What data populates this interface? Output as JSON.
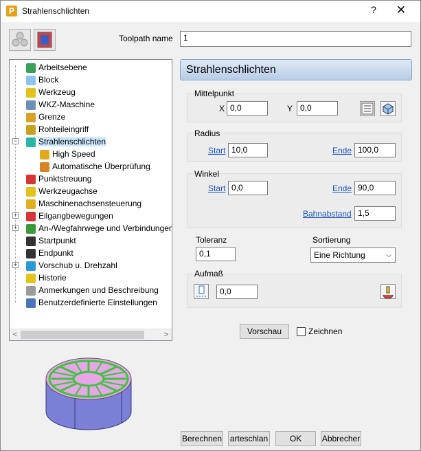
{
  "window": {
    "title": "Strahlenschlichten",
    "help": "?",
    "close": "✕",
    "app_icon_letter": "P"
  },
  "toolpath_name": {
    "label": "Toolpath name",
    "value": "1"
  },
  "tree": {
    "items": [
      {
        "label": "Arbeitsebene",
        "icon": "workplane-icon",
        "color": "#3aa05a"
      },
      {
        "label": "Block",
        "icon": "block-icon",
        "color": "#8fc3ec"
      },
      {
        "label": "Werkzeug",
        "icon": "tool-icon",
        "color": "#e3c21c"
      },
      {
        "label": "WKZ-Maschine",
        "icon": "machine-tool-icon",
        "color": "#6e8fb5"
      },
      {
        "label": "Grenze",
        "icon": "boundary-icon",
        "color": "#d9a02a"
      },
      {
        "label": "Rohteileingriff",
        "icon": "stock-engagement-icon",
        "color": "#c9a020"
      },
      {
        "label": "Strahlenschlichten",
        "icon": "radial-finishing-icon",
        "color": "#27b5a6"
      },
      {
        "label": "High Speed",
        "icon": "high-speed-icon",
        "color": "#e3a91c"
      },
      {
        "label": "Automatische Überprüfung",
        "icon": "auto-verify-icon",
        "color": "#d98424"
      },
      {
        "label": "Punktstreuung",
        "icon": "point-distribution-icon",
        "color": "#d73535"
      },
      {
        "label": "Werkzeugachse",
        "icon": "tool-axis-icon",
        "color": "#e3c21c"
      },
      {
        "label": "Maschinenachsensteuerung",
        "icon": "axis-control-icon",
        "color": "#e0b020"
      },
      {
        "label": "Eilgangbewegungen",
        "icon": "rapid-moves-icon",
        "color": "#d73535"
      },
      {
        "label": "An-/Wegfahrwege und Verbindungen",
        "icon": "leads-links-icon",
        "color": "#3a9a3a"
      },
      {
        "label": "Startpunkt",
        "icon": "start-point-icon",
        "color": "#333333"
      },
      {
        "label": "Endpunkt",
        "icon": "end-point-icon",
        "color": "#333333"
      },
      {
        "label": "Vorschub u. Drehzahl",
        "icon": "feeds-speeds-icon",
        "color": "#2a9ad6"
      },
      {
        "label": "Historie",
        "icon": "history-icon",
        "color": "#e3c21c"
      },
      {
        "label": "Anmerkungen und Beschreibung",
        "icon": "notes-icon",
        "color": "#9a9a9a"
      },
      {
        "label": "Benutzerdefinierte Einstellungen",
        "icon": "user-settings-icon",
        "color": "#4a76b8"
      }
    ]
  },
  "panel_header": "Strahlenschlichten",
  "mittelpunkt": {
    "title": "Mittelpunkt",
    "x_label": "X",
    "x_value": "0,0",
    "y_label": "Y",
    "y_value": "0,0"
  },
  "radius": {
    "title": "Radius",
    "start_label": "Start",
    "start_value": "10,0",
    "ende_label": "Ende",
    "ende_value": "100,0"
  },
  "winkel": {
    "title": "Winkel",
    "start_label": "Start",
    "start_value": "0,0",
    "ende_label": "Ende",
    "ende_value": "90,0",
    "bahn_label": "Bahnabstand",
    "bahn_value": "1,5"
  },
  "toleranz": {
    "label": "Toleranz",
    "value": "0,1"
  },
  "sortierung": {
    "label": "Sortierung",
    "value": "Eine Richtung"
  },
  "aufmass": {
    "title": "Aufmaß",
    "value": "0,0"
  },
  "vorschau": {
    "button": "Vorschau",
    "zeichnen": "Zeichnen"
  },
  "footer": {
    "berechnen": "Berechnen",
    "vorlage": "arteschlan",
    "ok": "OK",
    "abbrechen": "Abbrecher"
  },
  "colors": {
    "accent_link": "#1a55c4",
    "preview_top": "#e8a6e8",
    "preview_side": "#7b7fd6",
    "preview_path": "#3ec43e"
  }
}
